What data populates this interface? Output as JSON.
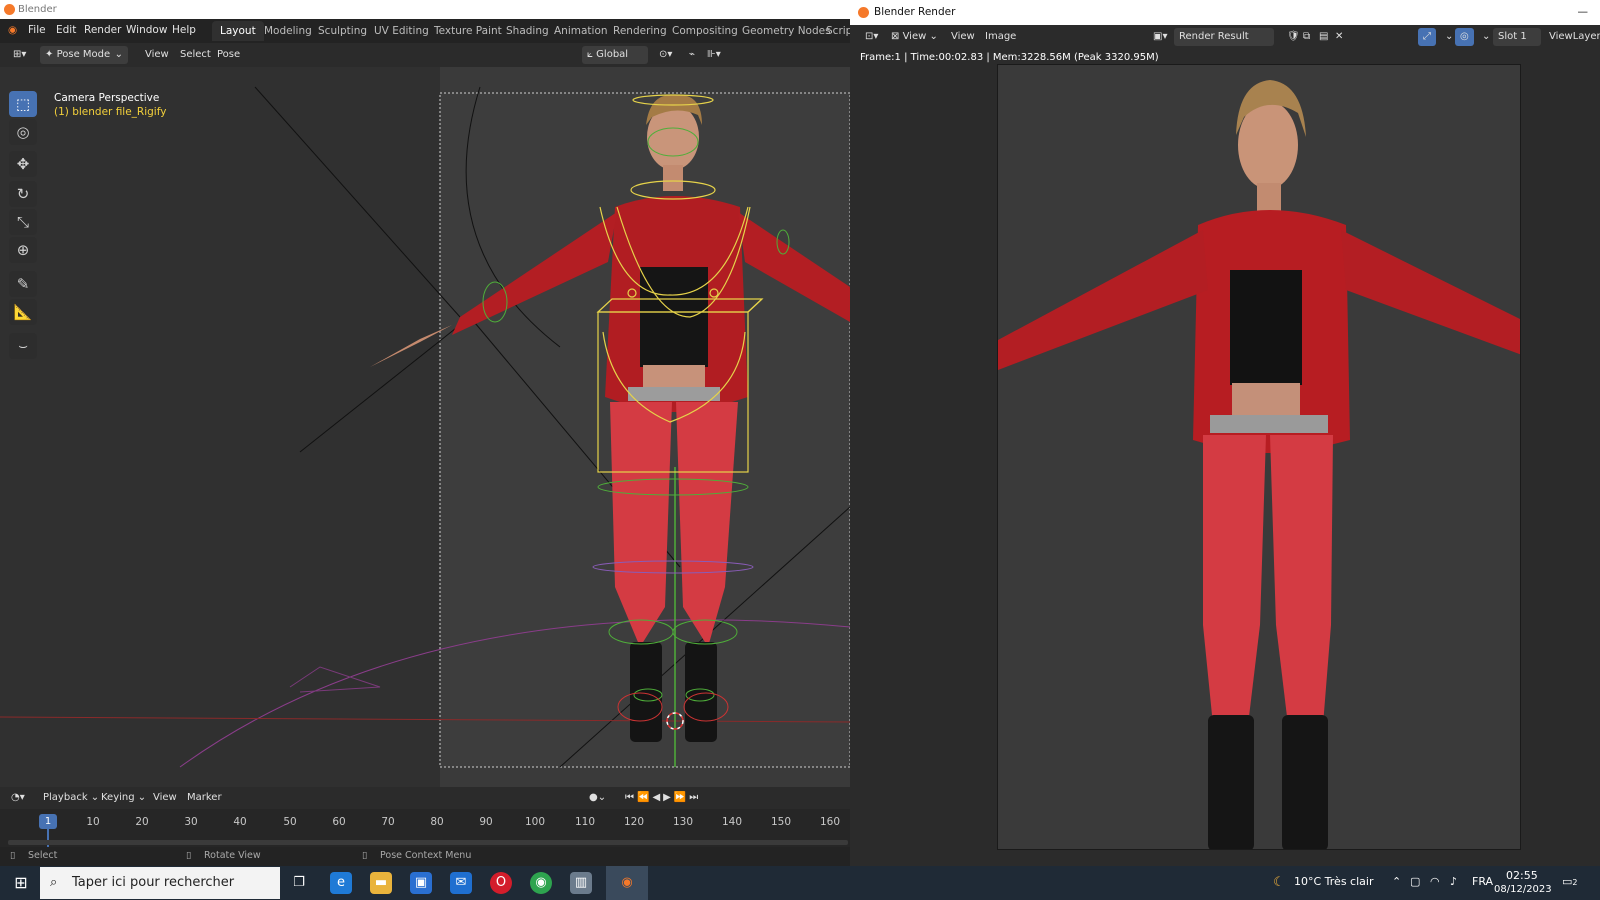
{
  "app": {
    "window_title": "Blender",
    "menus": [
      "File",
      "Edit",
      "Render",
      "Window",
      "Help"
    ],
    "workspace_tabs": [
      "Layout",
      "Modeling",
      "Sculpting",
      "UV Editing",
      "Texture Paint",
      "Shading",
      "Animation",
      "Rendering",
      "Compositing",
      "Geometry Nodes",
      "Scripting"
    ],
    "active_tab": "Layout"
  },
  "header": {
    "mode": "Pose Mode",
    "menus": [
      "View",
      "Select",
      "Pose"
    ],
    "orientation": "Global"
  },
  "viewport": {
    "info_line1": "Camera Perspective",
    "info_line2": "(1) blender file_Rigify",
    "tools": [
      "select-box-icon",
      "cursor-icon",
      "move-icon",
      "rotate-icon",
      "scale-icon",
      "transform-icon",
      "annotate-icon",
      "measure-icon",
      "bone-roll-icon"
    ]
  },
  "timeline": {
    "menus": [
      "Playback",
      "Keying",
      "View",
      "Marker"
    ],
    "current_frame": "1",
    "ticks": [
      "10",
      "20",
      "30",
      "40",
      "50",
      "60",
      "70",
      "80",
      "90",
      "100",
      "110",
      "120",
      "130",
      "140",
      "150",
      "160"
    ]
  },
  "status": {
    "select": "Select",
    "rotate": "Rotate View",
    "context": "Pose Context Menu"
  },
  "render_window": {
    "title": "Blender Render",
    "menus": [
      "View",
      "View",
      "Image"
    ],
    "image_name": "Render Result",
    "slot": "Slot 1",
    "view_layer": "ViewLayer",
    "info": "Frame:1 | Time:00:02.83 | Mem:3228.56M (Peak 3320.95M)"
  },
  "taskbar": {
    "search_placeholder": "Taper ici pour rechercher",
    "weather": "10°C  Très clair",
    "language": "FRA",
    "time": "02:55",
    "date": "08/12/2023",
    "notification_count": "2"
  },
  "colors": {
    "accent": "#4772b3",
    "rig_yellow": "#e6d34a",
    "rig_green": "#4fae3a",
    "jacket_red": "#c01f24"
  }
}
